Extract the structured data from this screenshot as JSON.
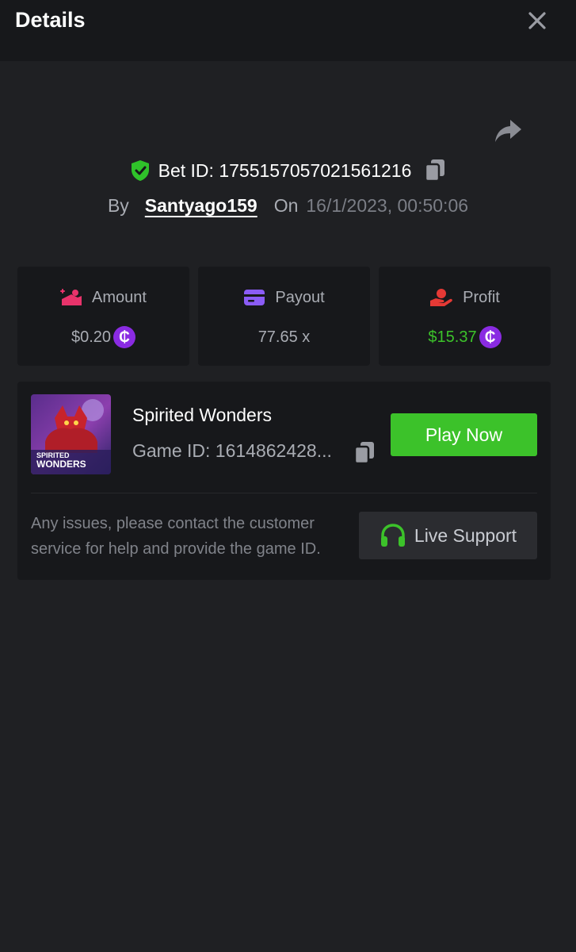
{
  "header": {
    "title": "Details"
  },
  "bet": {
    "id_text": "Bet ID: 1755157057021561216",
    "by_label": "By",
    "username": "Santyago159",
    "on_label": "On",
    "datetime": "16/1/2023, 00:50:06"
  },
  "stats": {
    "amount": {
      "label": "Amount",
      "value": "$0.20",
      "icon": "amount-icon"
    },
    "payout": {
      "label": "Payout",
      "value": "77.65 x",
      "icon": "card-icon"
    },
    "profit": {
      "label": "Profit",
      "value": "$15.37",
      "icon": "profit-hand-icon"
    }
  },
  "coin_symbol": "₵",
  "game": {
    "name": "Spirited Wonders",
    "id_text": "Game ID: 1614862428...",
    "thumb_text_line1": "SPIRITED",
    "thumb_text_line2": "WONDERS",
    "play_label": "Play Now",
    "help_text": "Any issues, please contact the customer service for help and provide the game ID.",
    "support_label": "Live Support"
  },
  "colors": {
    "background": "#1f2023",
    "card": "#17181b",
    "accent_green": "#3cc22a",
    "profit_green": "#3cc22a",
    "coin_purple": "#8a2be2",
    "amount_pink": "#e8336b",
    "payout_purple": "#8b5cf6",
    "profit_red": "#e53935"
  }
}
